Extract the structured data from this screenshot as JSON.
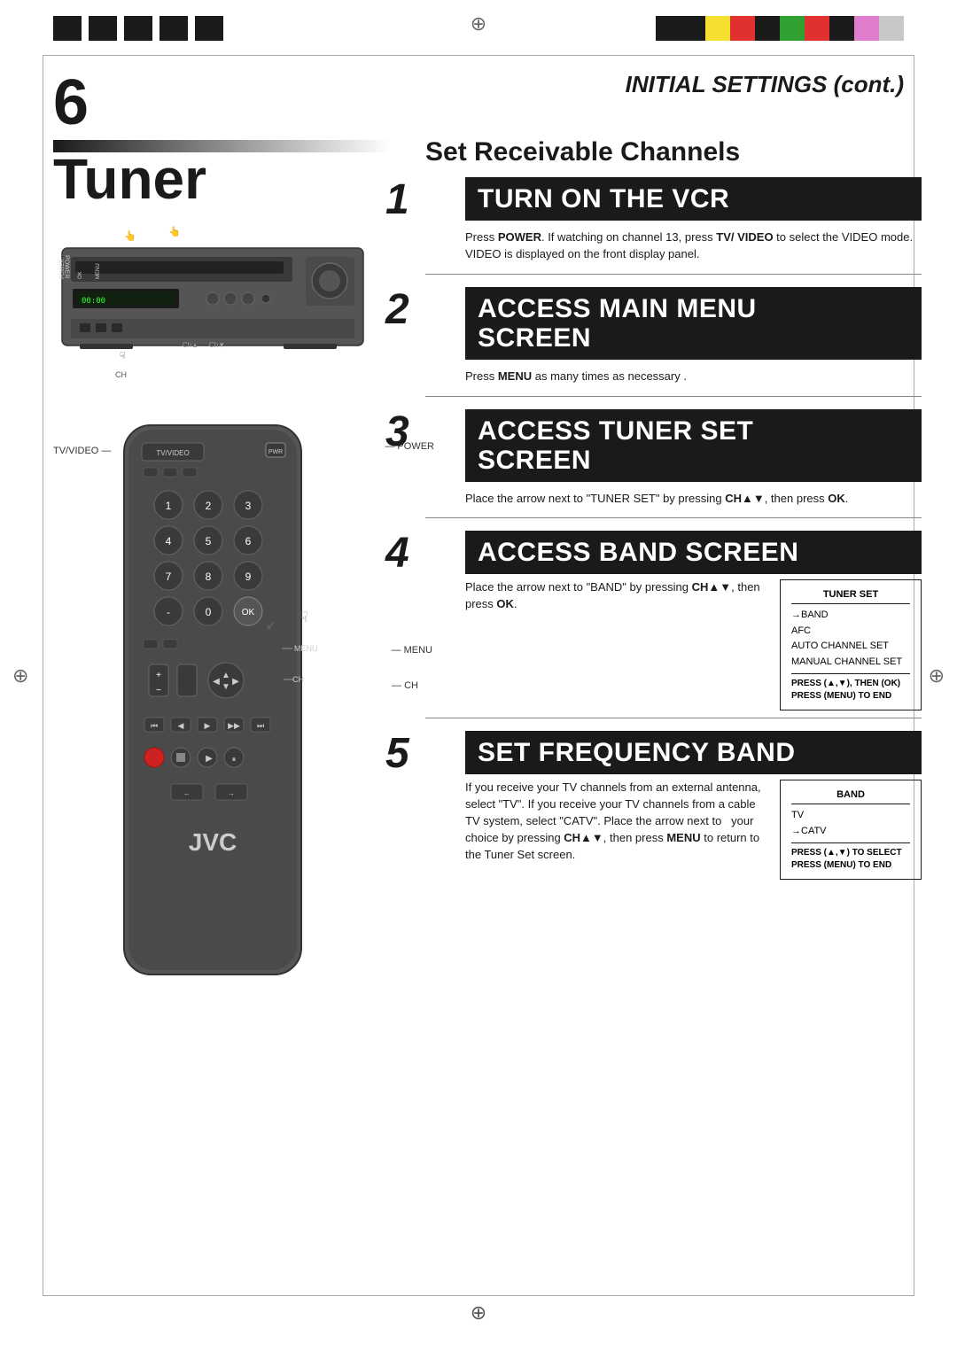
{
  "page": {
    "number": "6",
    "title": "INITIAL SETTINGS (cont.)"
  },
  "colors": {
    "bar": [
      "#1a1a1a",
      "#1a1a1a",
      "#1a1a1a",
      "#1a1a1a",
      "#f5e642",
      "#e8433a",
      "#1a1a1a",
      "#3a9e3a",
      "#e8433a",
      "#1a1a1a",
      "#e87dd4",
      "#c8c8c8"
    ]
  },
  "tuner": {
    "heading": "Tuner",
    "set_receivable": "Set Receivable Channels"
  },
  "steps": [
    {
      "number": "1",
      "header": "TURN ON THE VCR",
      "header_lines": [
        "TURN ON THE VCR"
      ],
      "body": "Press POWER. If watching on channel 13, press TV/ VIDEO to select the VIDEO mode. VIDEO is displayed on the front display panel."
    },
    {
      "number": "2",
      "header_lines": [
        "ACCESS MAIN MENU",
        "SCREEN"
      ],
      "body": "Press MENU as many times as necessary ."
    },
    {
      "number": "3",
      "header_lines": [
        "ACCESS TUNER SET",
        "SCREEN"
      ],
      "body": "Place the arrow next to \"TUNER SET\" by pressing CH▲▼, then press OK."
    },
    {
      "number": "4",
      "header_lines": [
        "ACCESS BAND SCREEN"
      ],
      "body": "Place the arrow next to \"BAND\" by pressing CH▲▼, then press OK.",
      "menu": {
        "title": "TUNER SET",
        "items": [
          "→BAND",
          "AFC",
          "AUTO CHANNEL SET",
          "MANUAL CHANNEL SET"
        ],
        "footer": "PRESS (▲,▼), THEN (OK)\nPRESS (MENU) TO END"
      }
    },
    {
      "number": "5",
      "header_lines": [
        "SET FREQUENCY BAND"
      ],
      "body": "If you receive your TV channels from an external antenna, select \"TV\". If you receive your TV channels from a cable TV system, select \"CATV\". Place the arrow next to your choice by pressing CH▲▼, then press MENU to return to the Tuner Set screen.",
      "menu": {
        "title": "BAND",
        "items": [
          "TV",
          "→CATV"
        ],
        "footer": "PRESS (▲,▼) TO SELECT\nPRESS (MENU) TO END"
      }
    }
  ]
}
